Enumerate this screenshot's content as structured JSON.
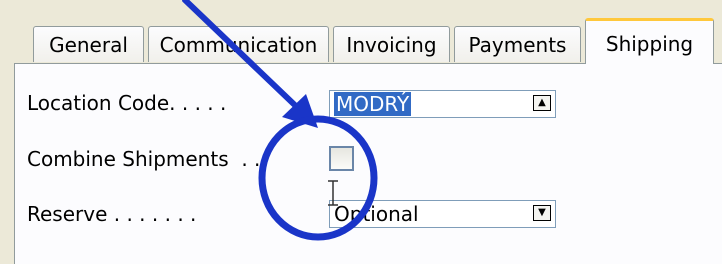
{
  "tabs": [
    {
      "label": "General"
    },
    {
      "label": "Communication"
    },
    {
      "label": "Invoicing"
    },
    {
      "label": "Payments"
    },
    {
      "label": "Shipping",
      "active": true
    }
  ],
  "form": {
    "location_code": {
      "label": "Location Code. . . . .",
      "value": "MODRÝ",
      "button_icon": "lookup-arrow-up-icon"
    },
    "combine_shipments": {
      "label": "Combine Shipments  . .",
      "checked": false
    },
    "reserve": {
      "label": "Reserve . . . . . . .",
      "value": "Optional",
      "button_icon": "dropdown-arrow-icon"
    }
  },
  "annotation": {
    "color": "#1a35c8",
    "shapes": [
      "arrow",
      "circle"
    ]
  }
}
